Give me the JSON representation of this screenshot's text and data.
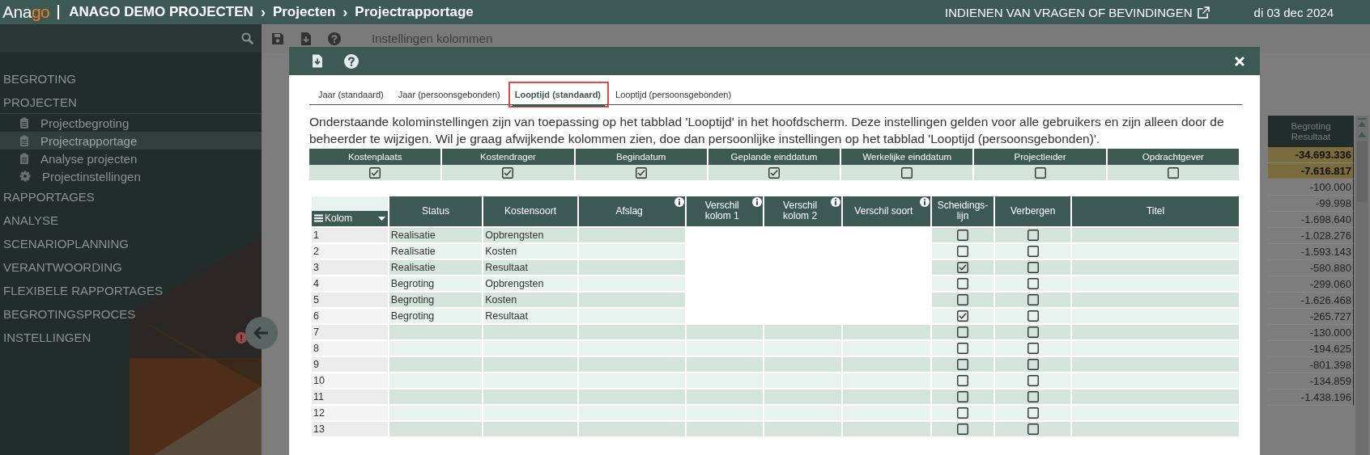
{
  "header": {
    "logo": {
      "text": "Ana",
      "accent": "go"
    },
    "breadcrumbs": [
      "ANAGO DEMO PROJECTEN",
      "Projecten",
      "Projectrapportage"
    ],
    "breadcrumb_separator": "›",
    "feedback_link": "INDIENEN VAN VRAGEN OF BEVINDINGEN",
    "date": "di 03 dec 2024"
  },
  "sidebar": {
    "items": [
      {
        "label": "BEGROTING",
        "alert": false
      },
      {
        "label": "PROJECTEN",
        "alert": false,
        "children": [
          {
            "label": "Projectbegroting",
            "kind": "page",
            "selected": false
          },
          {
            "label": "Projectrapportage",
            "kind": "page",
            "selected": true
          },
          {
            "label": "Analyse projecten",
            "kind": "page",
            "selected": false
          },
          {
            "label": "Projectinstellingen",
            "kind": "settings",
            "selected": false
          }
        ]
      },
      {
        "label": "RAPPORTAGES",
        "alert": false
      },
      {
        "label": "ANALYSE",
        "alert": false
      },
      {
        "label": "SCENARIOPLANNING",
        "alert": false
      },
      {
        "label": "VERANTWOORDING",
        "alert": false
      },
      {
        "label": "FLEXIBELE RAPPORTAGES",
        "alert": false
      },
      {
        "label": "BEGROTINGSPROCES",
        "alert": false
      },
      {
        "label": "INSTELLINGEN",
        "alert": true
      }
    ]
  },
  "toolbar": {
    "title": "Instellingen kolommen"
  },
  "background_table": {
    "column": "Begroting Resultaat",
    "values": [
      {
        "value": "-34.693.336",
        "highlighted": true
      },
      {
        "value": "-7.616.817",
        "highlighted": true
      },
      {
        "value": "-100.000",
        "highlighted": false
      },
      {
        "value": "-99.998",
        "highlighted": false
      },
      {
        "value": "-1.698.640",
        "highlighted": false
      },
      {
        "value": "-1.028.276",
        "highlighted": false
      },
      {
        "value": "-1.593.143",
        "highlighted": false
      },
      {
        "value": "-580.880",
        "highlighted": false
      },
      {
        "value": "-299.060",
        "highlighted": false
      },
      {
        "value": "-1.626.468",
        "highlighted": false
      },
      {
        "value": "-265.727",
        "highlighted": false
      },
      {
        "value": "-130.000",
        "highlighted": false
      },
      {
        "value": "-194.625",
        "highlighted": false
      },
      {
        "value": "-801.398",
        "highlighted": false
      },
      {
        "value": "-134.859",
        "highlighted": false
      },
      {
        "value": "-1.438.196",
        "highlighted": false
      }
    ]
  },
  "modal": {
    "tabs": [
      {
        "label": "Jaar (standaard)",
        "selected": false,
        "highlighted": false
      },
      {
        "label": "Jaar (persoonsgebonden)",
        "selected": false,
        "highlighted": false
      },
      {
        "label": "Looptijd (standaard)",
        "selected": true,
        "highlighted": true
      },
      {
        "label": "Looptijd (persoonsgebonden)",
        "selected": false,
        "highlighted": false
      }
    ],
    "description": "Onderstaande kolominstellingen zijn van toepassing op het tabblad 'Looptijd' in het hoofdscherm. Deze instellingen gelden voor alle gebruikers en zijn alleen door de beheerder te wijzigen. Wil je graag afwijkende kolommen zien, doe dan persoonlijke instellingen op het tabblad 'Looptijd (persoonsgebonden)'.",
    "general_columns": [
      {
        "label": "Kostenplaats",
        "checked": true
      },
      {
        "label": "Kostendrager",
        "checked": true
      },
      {
        "label": "Begindatum",
        "checked": true
      },
      {
        "label": "Geplande einddatum",
        "checked": true
      },
      {
        "label": "Werkelijke einddatum",
        "checked": false
      },
      {
        "label": "Projectleider",
        "checked": false
      },
      {
        "label": "Opdrachtgever",
        "checked": false
      }
    ],
    "table": {
      "columns": [
        {
          "label": "Kolom",
          "kind": "menu"
        },
        {
          "label": "Status",
          "kind": "text"
        },
        {
          "label": "Kostensoort",
          "kind": "text"
        },
        {
          "label": "Afslag",
          "kind": "text",
          "info": true
        },
        {
          "label": "Verschil kolom 1",
          "kind": "text",
          "info": true
        },
        {
          "label": "Verschil kolom 2",
          "kind": "text",
          "info": true
        },
        {
          "label": "Verschil soort",
          "kind": "text",
          "info": true
        },
        {
          "label": "Scheidings-lijn",
          "kind": "text"
        },
        {
          "label": "Verbergen",
          "kind": "text"
        },
        {
          "label": "Titel",
          "kind": "text"
        }
      ],
      "rows": [
        {
          "number": "1",
          "status": "Realisatie",
          "cost_type": "Opbrengsten",
          "difference_enabled": false,
          "separator": false,
          "hidden": false
        },
        {
          "number": "2",
          "status": "Realisatie",
          "cost_type": "Kosten",
          "difference_enabled": false,
          "separator": false,
          "hidden": false
        },
        {
          "number": "3",
          "status": "Realisatie",
          "cost_type": "Resultaat",
          "difference_enabled": false,
          "separator": true,
          "hidden": false
        },
        {
          "number": "4",
          "status": "Begroting",
          "cost_type": "Opbrengsten",
          "difference_enabled": false,
          "separator": false,
          "hidden": false
        },
        {
          "number": "5",
          "status": "Begroting",
          "cost_type": "Kosten",
          "difference_enabled": false,
          "separator": false,
          "hidden": false
        },
        {
          "number": "6",
          "status": "Begroting",
          "cost_type": "Resultaat",
          "difference_enabled": false,
          "separator": true,
          "hidden": false
        },
        {
          "number": "7",
          "difference_enabled": true,
          "separator": false,
          "hidden": false
        },
        {
          "number": "8",
          "difference_enabled": true,
          "separator": false,
          "hidden": false
        },
        {
          "number": "9",
          "difference_enabled": true,
          "separator": false,
          "hidden": false
        },
        {
          "number": "10",
          "difference_enabled": true,
          "separator": false,
          "hidden": false
        },
        {
          "number": "11",
          "difference_enabled": true,
          "separator": false,
          "hidden": false
        },
        {
          "number": "12",
          "difference_enabled": true,
          "separator": false,
          "hidden": false
        },
        {
          "number": "13",
          "difference_enabled": true,
          "separator": false,
          "hidden": false
        }
      ]
    }
  }
}
